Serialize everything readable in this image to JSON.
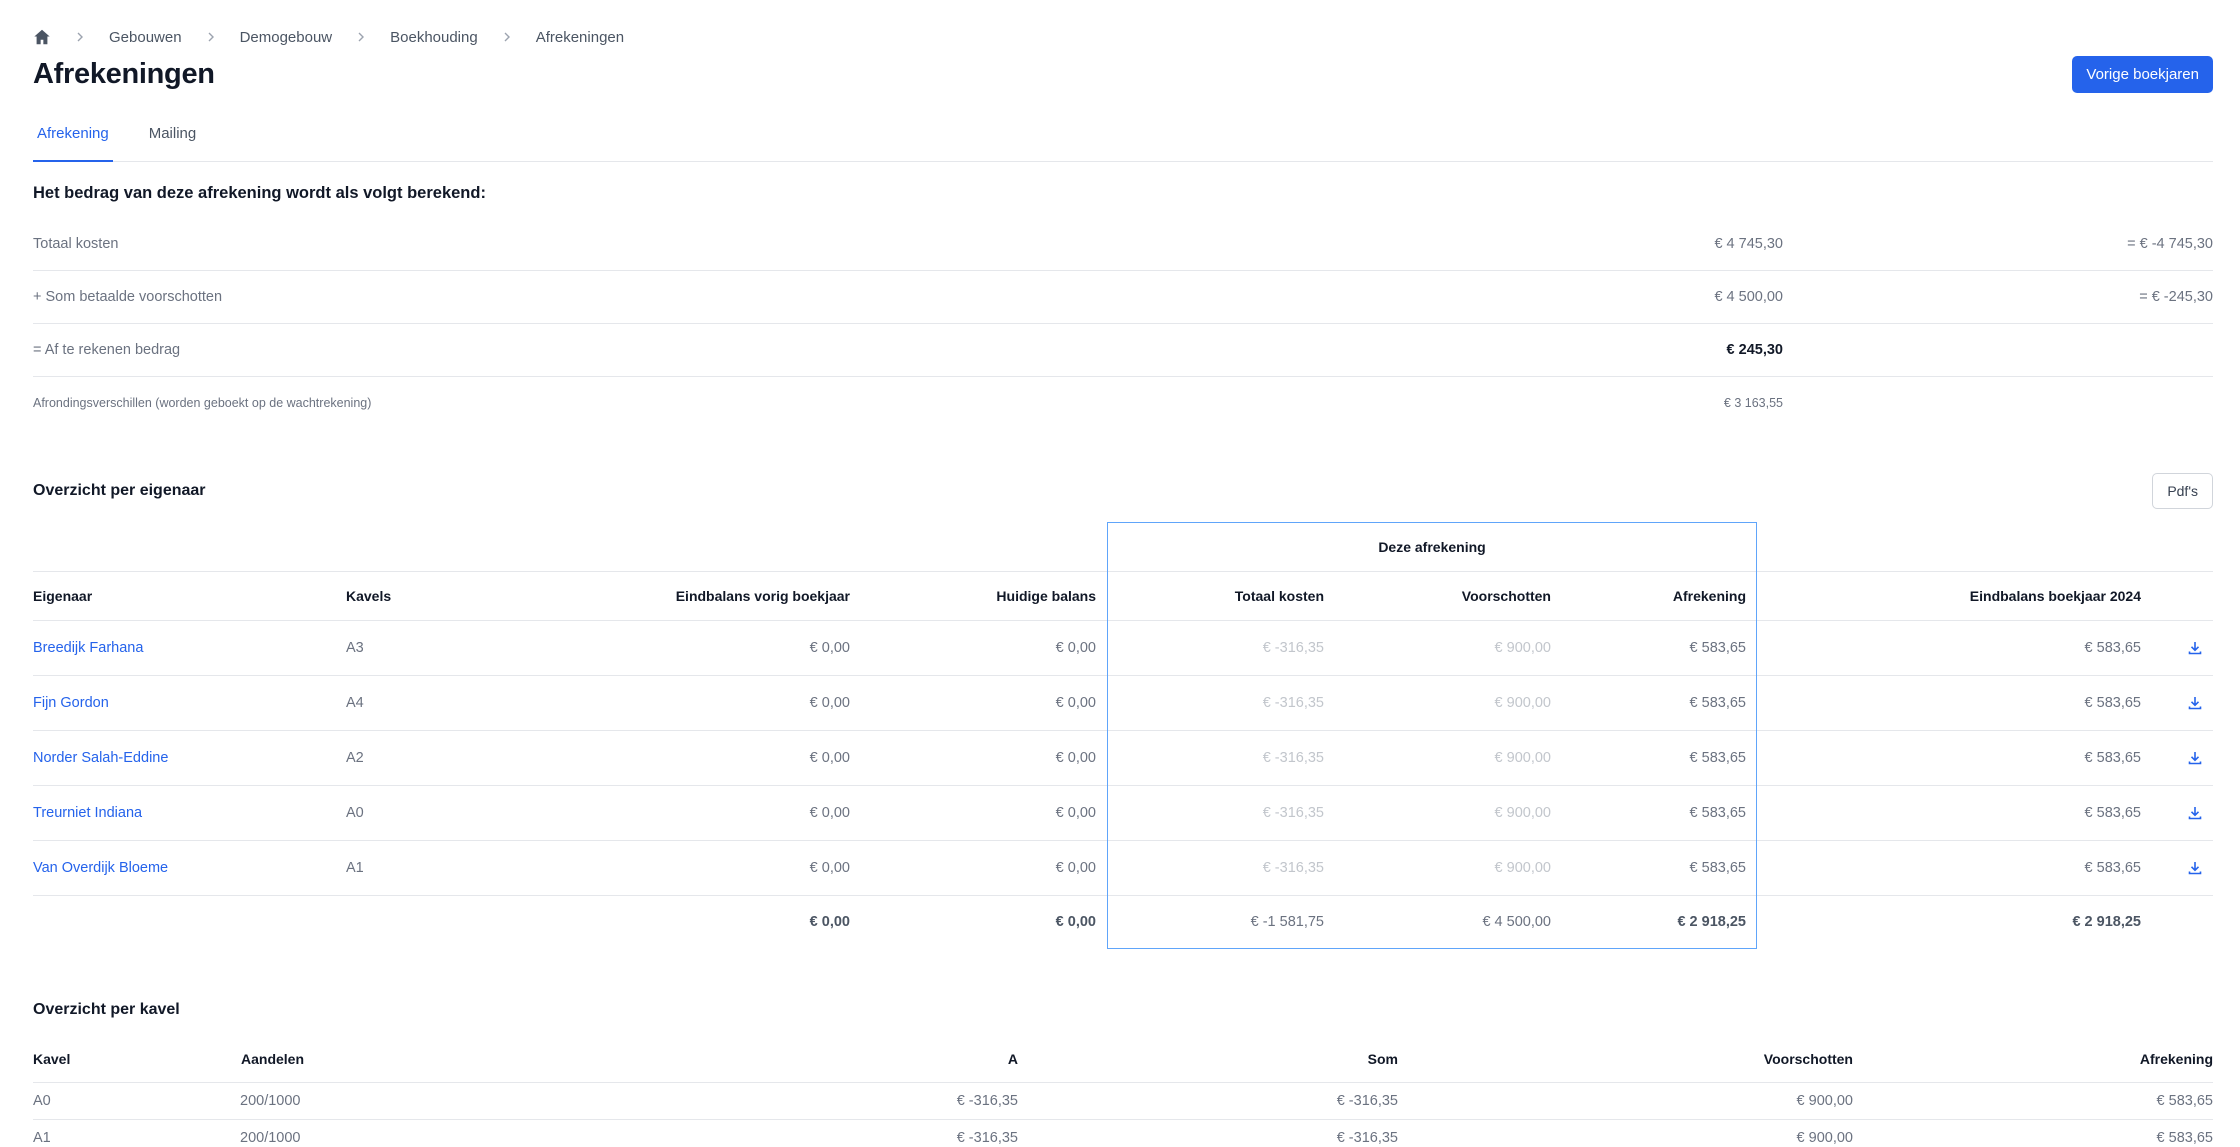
{
  "breadcrumb": {
    "home_icon": "home-icon",
    "items": [
      "Gebouwen",
      "Demogebouw",
      "Boekhouding",
      "Afrekeningen"
    ]
  },
  "header": {
    "title": "Afrekeningen",
    "prev_years_button": "Vorige boekjaren"
  },
  "tabs": [
    {
      "label": "Afrekening",
      "active": true
    },
    {
      "label": "Mailing",
      "active": false
    }
  ],
  "calculation": {
    "heading": "Het bedrag van deze afrekening wordt als volgt berekend:",
    "rows": [
      {
        "label": "Totaal kosten",
        "amount": "€ 4 745,30",
        "result": "= € -4 745,30"
      },
      {
        "label": "+ Som betaalde voorschotten",
        "amount": "€ 4 500,00",
        "result": "= € -245,30"
      },
      {
        "label": "= Af te rekenen bedrag",
        "amount": "€ 245,30",
        "result": ""
      },
      {
        "label": "Afrondingsverschillen (worden geboekt op de wachtrekening)",
        "amount": "€ 3 163,55",
        "result": ""
      }
    ]
  },
  "owners": {
    "title": "Overzicht per eigenaar",
    "pdf_button": "Pdf's",
    "group_label": "Deze afrekening",
    "headers": {
      "owner": "Eigenaar",
      "kavels": "Kavels",
      "prev_balance": "Eindbalans vorig boekjaar",
      "current_balance": "Huidige balans",
      "total_costs": "Totaal kosten",
      "advances": "Voorschotten",
      "settlement": "Afrekening",
      "end_balance": "Eindbalans boekjaar 2024"
    },
    "rows": [
      {
        "owner": "Breedijk Farhana",
        "kavels": "A3",
        "prev_balance": "€ 0,00",
        "current_balance": "€ 0,00",
        "total_costs": "€ -316,35",
        "advances": "€ 900,00",
        "settlement": "€ 583,65",
        "end_balance": "€ 583,65"
      },
      {
        "owner": "Fijn Gordon",
        "kavels": "A4",
        "prev_balance": "€ 0,00",
        "current_balance": "€ 0,00",
        "total_costs": "€ -316,35",
        "advances": "€ 900,00",
        "settlement": "€ 583,65",
        "end_balance": "€ 583,65"
      },
      {
        "owner": "Norder Salah-Eddine",
        "kavels": "A2",
        "prev_balance": "€ 0,00",
        "current_balance": "€ 0,00",
        "total_costs": "€ -316,35",
        "advances": "€ 900,00",
        "settlement": "€ 583,65",
        "end_balance": "€ 583,65"
      },
      {
        "owner": "Treurniet Indiana",
        "kavels": "A0",
        "prev_balance": "€ 0,00",
        "current_balance": "€ 0,00",
        "total_costs": "€ -316,35",
        "advances": "€ 900,00",
        "settlement": "€ 583,65",
        "end_balance": "€ 583,65"
      },
      {
        "owner": "Van Overdijk Bloeme",
        "kavels": "A1",
        "prev_balance": "€ 0,00",
        "current_balance": "€ 0,00",
        "total_costs": "€ -316,35",
        "advances": "€ 900,00",
        "settlement": "€ 583,65",
        "end_balance": "€ 583,65"
      }
    ],
    "totals": {
      "prev_balance": "€ 0,00",
      "current_balance": "€ 0,00",
      "total_costs": "€ -1 581,75",
      "advances": "€ 4 500,00",
      "settlement": "€ 2 918,25",
      "end_balance": "€ 2 918,25"
    },
    "row_icon": "download-icon"
  },
  "kavels": {
    "title": "Overzicht per kavel",
    "headers": {
      "kavel": "Kavel",
      "shares": "Aandelen",
      "a": "A",
      "sum": "Som",
      "advances": "Voorschotten",
      "settlement": "Afrekening"
    },
    "rows": [
      {
        "kavel": "A0",
        "shares": "200/1000",
        "a": "€ -316,35",
        "sum": "€ -316,35",
        "advances": "€ 900,00",
        "settlement": "€ 583,65"
      },
      {
        "kavel": "A1",
        "shares": "200/1000",
        "a": "€ -316,35",
        "sum": "€ -316,35",
        "advances": "€ 900,00",
        "settlement": "€ 583,65"
      }
    ]
  },
  "colors": {
    "accent": "#2563eb",
    "highlight_border": "#60a5fa",
    "text": "#111827",
    "muted": "#6b7280",
    "faint": "#c2c6cc"
  }
}
